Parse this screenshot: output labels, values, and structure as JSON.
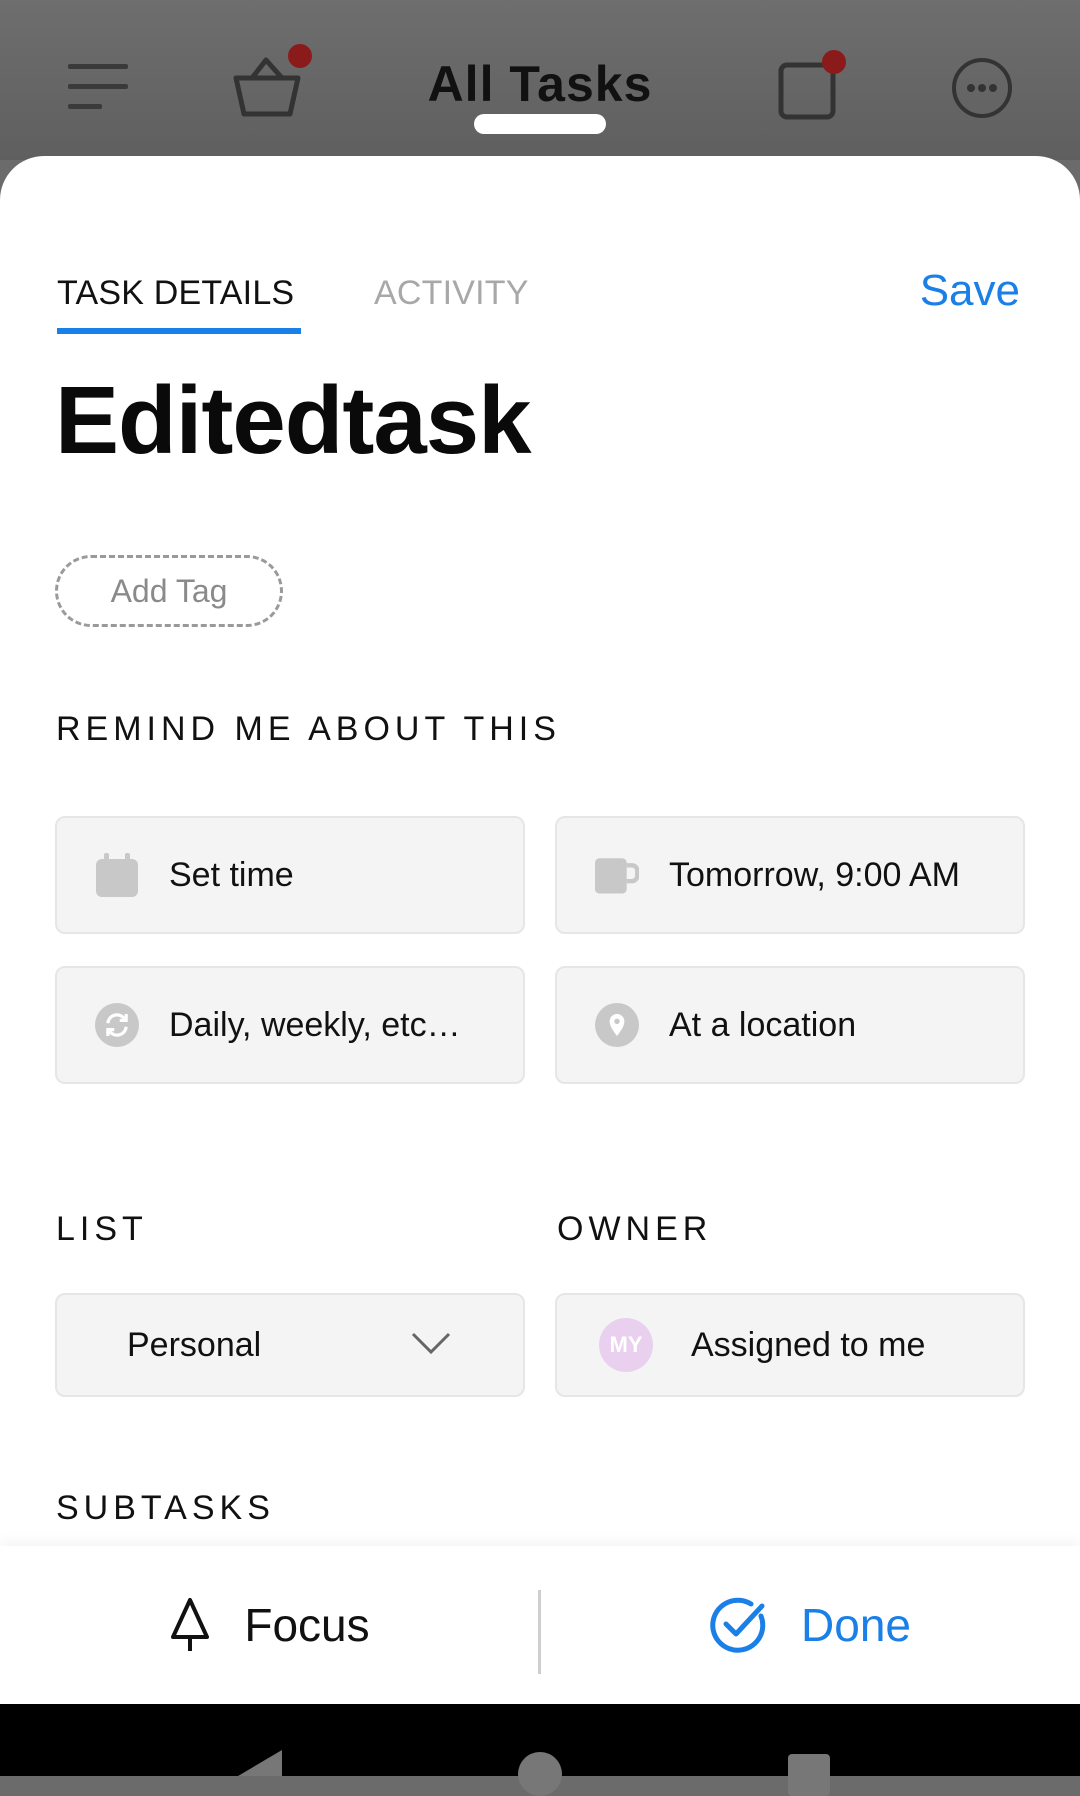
{
  "app_bar": {
    "title": "All Tasks",
    "icons": [
      "menu-icon",
      "basket-icon",
      "notes-icon",
      "more-icon"
    ]
  },
  "tabs": [
    {
      "label": "TASK DETAILS",
      "active": true
    },
    {
      "label": "ACTIVITY",
      "active": false
    }
  ],
  "save_label": "Save",
  "task": {
    "title": "Editedtask",
    "add_tag_label": "Add Tag"
  },
  "reminders": {
    "section_label": "REMIND ME ABOUT THIS",
    "options": [
      {
        "label": "Set time",
        "icon": "calendar-icon"
      },
      {
        "label": "Tomorrow, 9:00 AM",
        "icon": "coffee-mug-icon"
      },
      {
        "label": "Daily, weekly, etc…",
        "icon": "repeat-icon"
      },
      {
        "label": "At a location",
        "icon": "location-pin-icon"
      }
    ]
  },
  "list": {
    "section_label": "LIST",
    "selected": "Personal"
  },
  "owner": {
    "section_label": "OWNER",
    "avatar_initials": "MY",
    "label": "Assigned to me"
  },
  "subtasks": {
    "section_label": "SUBTASKS"
  },
  "actions": {
    "focus_label": "Focus",
    "done_label": "Done"
  },
  "colors": {
    "accent": "#1a7fe6",
    "notification_dot": "#8b1a1a",
    "avatar_bg": "#ead0ef"
  }
}
